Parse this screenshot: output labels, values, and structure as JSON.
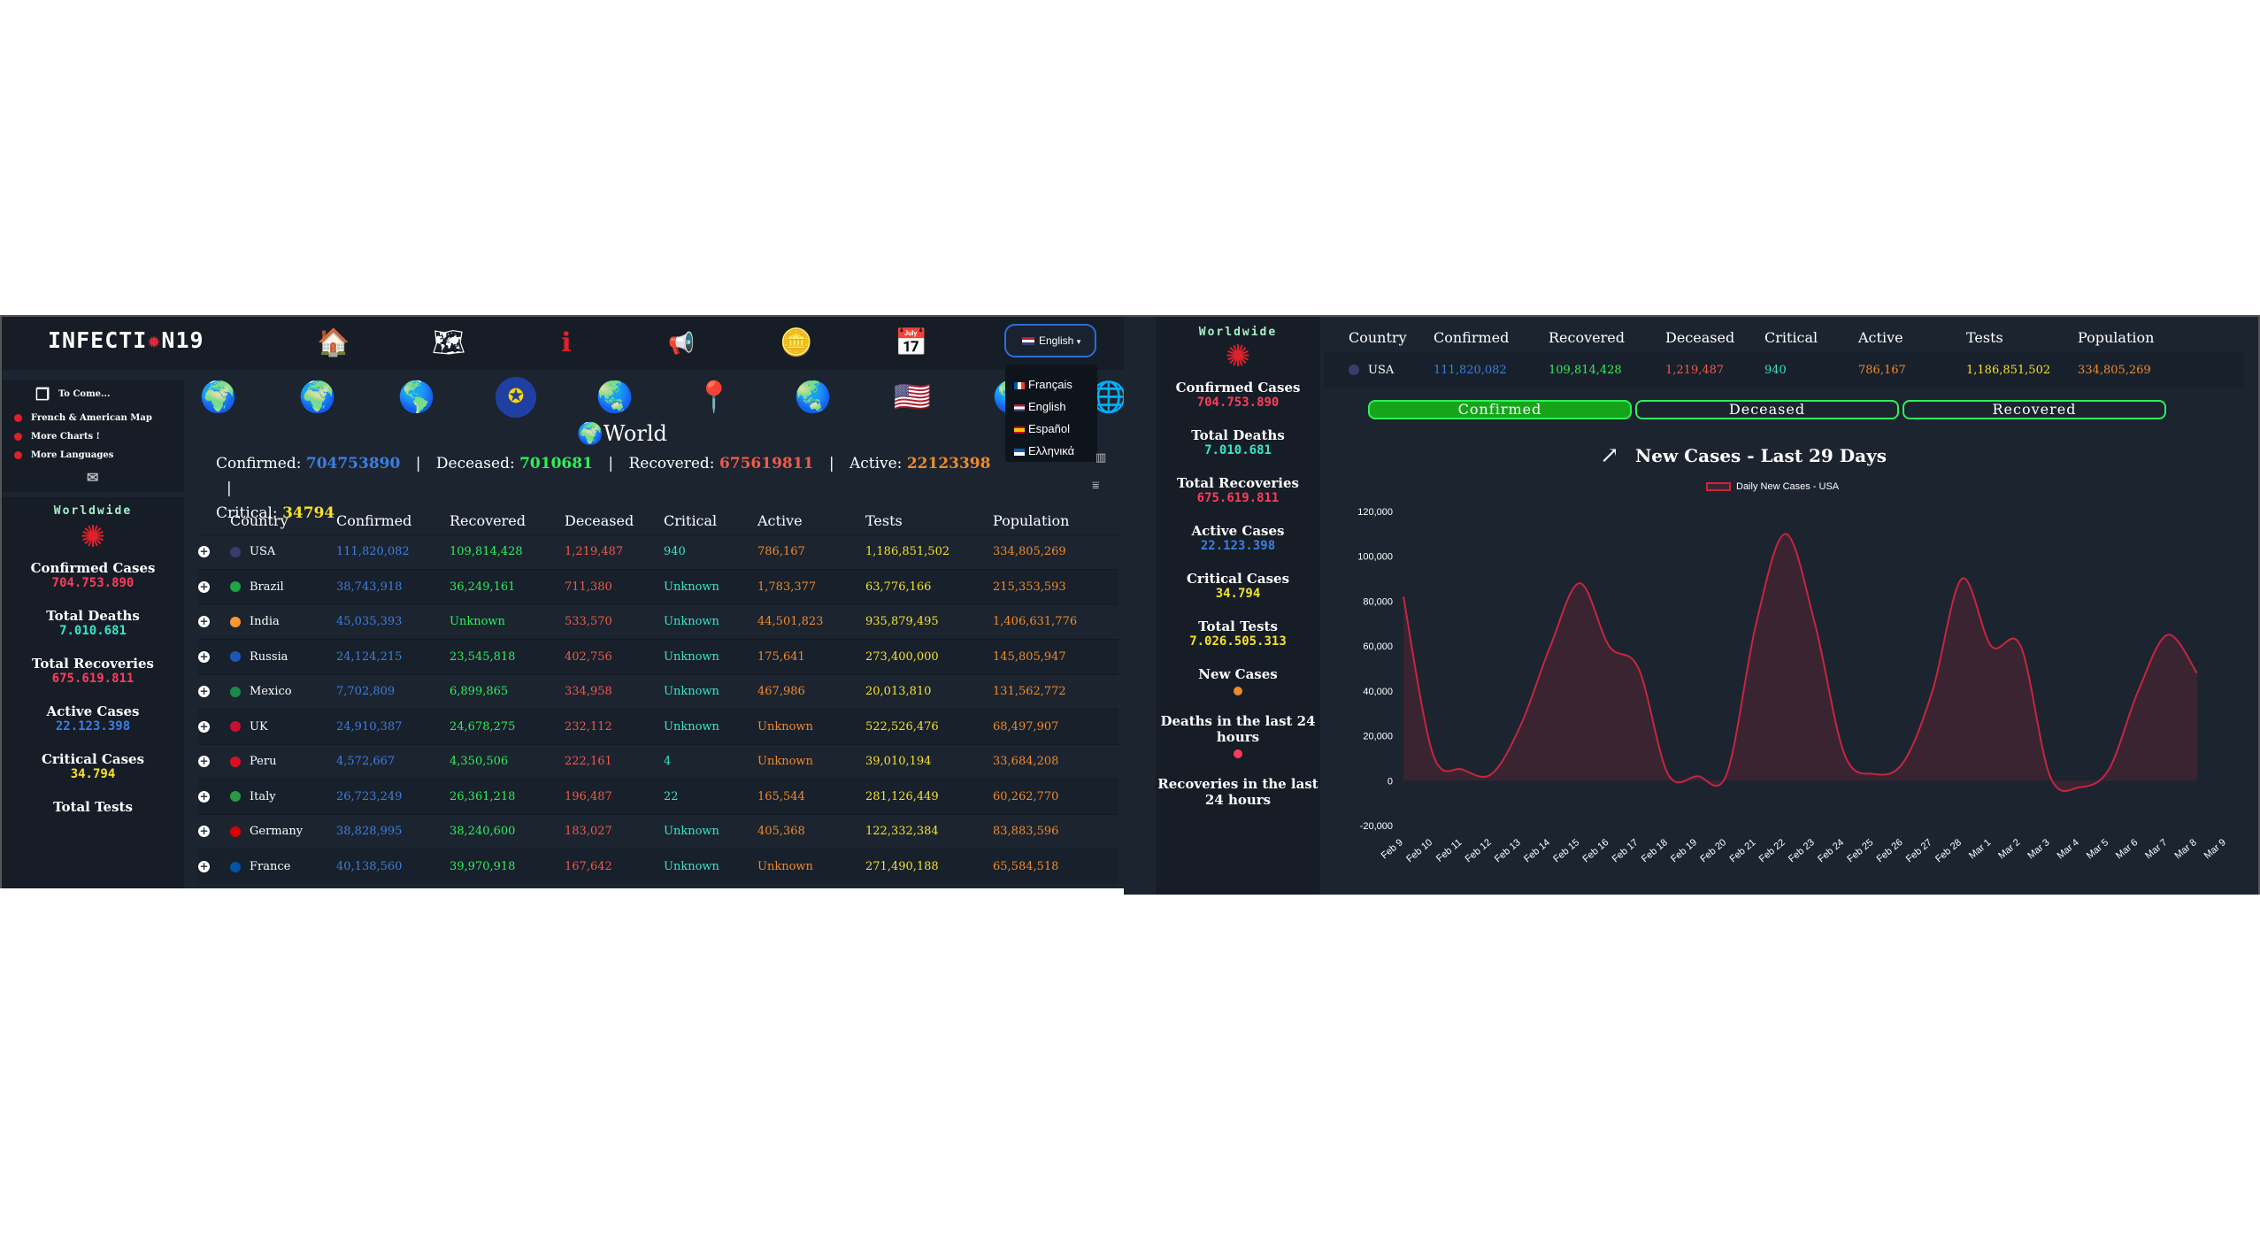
{
  "app": {
    "logo": "INFECTION19",
    "language_selected": "English",
    "languages": [
      "Français",
      "English",
      "Español",
      "Ελληνικά"
    ]
  },
  "nav_icons": [
    "home-icon",
    "map-icon",
    "info-icon",
    "megaphone-icon",
    "coins-icon",
    "calendar-icon"
  ],
  "region_icons": [
    "globe-icon",
    "africa-icon",
    "south-america-icon",
    "europe-icon",
    "asia-icon",
    "map-pin-icon",
    "oceania-icon",
    "usa-flag-map-icon",
    "north-america-icon",
    "world-icon"
  ],
  "side_menu": {
    "header": "To Come...",
    "items": [
      "French & American Map",
      "More Charts !",
      "More Languages"
    ]
  },
  "worldwide": {
    "title": "Worldwide",
    "confirmed_label": "Confirmed Cases",
    "confirmed_value": "704.753.890",
    "deaths_label": "Total Deaths",
    "deaths_value": "7.010.681",
    "recoveries_label": "Total Recoveries",
    "recoveries_value": "675.619.811",
    "active_label": "Active Cases",
    "active_value": "22.123.398",
    "critical_label": "Critical Cases",
    "critical_value": "34.794",
    "tests_label": "Total Tests",
    "tests_value": "7.026.505.313",
    "new_cases_label": "New Cases",
    "deaths24_label": "Deaths in the last 24 hours",
    "recoveries24_label": "Recoveries in the last 24 hours"
  },
  "world": {
    "title": "World",
    "confirmed_label": "Confirmed:",
    "confirmed": "704753890",
    "deceased_label": "Deceased:",
    "deceased": "7010681",
    "recovered_label": "Recovered:",
    "recovered": "675619811",
    "active_label": "Active:",
    "active": "22123398",
    "critical_label": "Critical:",
    "critical": "34794"
  },
  "table": {
    "headers": [
      "Country",
      "Confirmed",
      "Recovered",
      "Deceased",
      "Critical",
      "Active",
      "Tests",
      "Population"
    ],
    "rows": [
      {
        "country": "USA",
        "confirmed": "111,820,082",
        "recovered": "109,814,428",
        "deceased": "1,219,487",
        "critical": "940",
        "active": "786,167",
        "tests": "1,186,851,502",
        "population": "334,805,269",
        "flag": "#3c3b6e"
      },
      {
        "country": "Brazil",
        "confirmed": "38,743,918",
        "recovered": "36,249,161",
        "deceased": "711,380",
        "critical": "Unknown",
        "active": "1,783,377",
        "tests": "63,776,166",
        "population": "215,353,593",
        "flag": "#1ea345"
      },
      {
        "country": "India",
        "confirmed": "45,035,393",
        "recovered": "Unknown",
        "deceased": "533,570",
        "critical": "Unknown",
        "active": "44,501,823",
        "tests": "935,879,495",
        "population": "1,406,631,776",
        "flag": "#ff9933"
      },
      {
        "country": "Russia",
        "confirmed": "24,124,215",
        "recovered": "23,545,818",
        "deceased": "402,756",
        "critical": "Unknown",
        "active": "175,641",
        "tests": "273,400,000",
        "population": "145,805,947",
        "flag": "#1c57b8"
      },
      {
        "country": "Mexico",
        "confirmed": "7,702,809",
        "recovered": "6,899,865",
        "deceased": "334,958",
        "critical": "Unknown",
        "active": "467,986",
        "tests": "20,013,810",
        "population": "131,562,772",
        "flag": "#1a8a4a"
      },
      {
        "country": "UK",
        "confirmed": "24,910,387",
        "recovered": "24,678,275",
        "deceased": "232,112",
        "critical": "Unknown",
        "active": "Unknown",
        "tests": "522,526,476",
        "population": "68,497,907",
        "flag": "#c8102e"
      },
      {
        "country": "Peru",
        "confirmed": "4,572,667",
        "recovered": "4,350,506",
        "deceased": "222,161",
        "critical": "4",
        "active": "Unknown",
        "tests": "39,010,194",
        "population": "33,684,208",
        "flag": "#d91023"
      },
      {
        "country": "Italy",
        "confirmed": "26,723,249",
        "recovered": "26,361,218",
        "deceased": "196,487",
        "critical": "22",
        "active": "165,544",
        "tests": "281,126,449",
        "population": "60,262,770",
        "flag": "#2a9a44"
      },
      {
        "country": "Germany",
        "confirmed": "38,828,995",
        "recovered": "38,240,600",
        "deceased": "183,027",
        "critical": "Unknown",
        "active": "405,368",
        "tests": "122,332,384",
        "population": "83,883,596",
        "flag": "#dd0000"
      },
      {
        "country": "France",
        "confirmed": "40,138,560",
        "recovered": "39,970,918",
        "deceased": "167,642",
        "critical": "Unknown",
        "active": "Unknown",
        "tests": "271,490,188",
        "population": "65,584,518",
        "flag": "#0055a4"
      }
    ]
  },
  "tabs": [
    "Confirmed",
    "Deceased",
    "Recovered"
  ],
  "colors": {
    "confirmed": "#3b7fe0",
    "recovered": "#2df05a",
    "deceased": "#f05a48",
    "critical": "#37e6c8",
    "active": "#f08a2a",
    "tests": "#f5e12a",
    "line": "#c8253f",
    "tab_active": "#16a51a"
  },
  "chart_data": {
    "type": "line",
    "title": "New Cases - Last 29 Days",
    "series": [
      {
        "name": "Daily New Cases - USA",
        "values": [
          82000,
          12000,
          5000,
          3000,
          25000,
          60000,
          88000,
          60000,
          50000,
          3000,
          2000,
          3000,
          70000,
          110000,
          70000,
          12000,
          3000,
          8000,
          40000,
          90000,
          60000,
          60000,
          2000,
          -3000,
          5000,
          40000,
          65000,
          48000
        ]
      }
    ],
    "x": [
      "Feb 9",
      "Feb 10",
      "Feb 11",
      "Feb 12",
      "Feb 13",
      "Feb 14",
      "Feb 15",
      "Feb 16",
      "Feb 17",
      "Feb 18",
      "Feb 19",
      "Feb 20",
      "Feb 21",
      "Feb 22",
      "Feb 23",
      "Feb 24",
      "Feb 25",
      "Feb 26",
      "Feb 27",
      "Feb 28",
      "Mar 1",
      "Mar 2",
      "Mar 3",
      "Mar 4",
      "Mar 5",
      "Mar 6",
      "Mar 7",
      "Mar 8",
      "Mar 9"
    ],
    "yticks": [
      "120,000",
      "100,000",
      "80,000",
      "60,000",
      "40,000",
      "20,000",
      "0",
      "-20,000"
    ],
    "ylim": [
      -20000,
      120000
    ]
  }
}
